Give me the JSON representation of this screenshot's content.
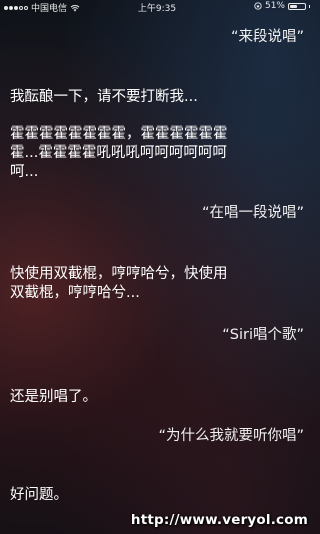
{
  "status_bar": {
    "carrier": "中国电信",
    "time": "上午9:35",
    "battery_text": "51%",
    "battery_level": 0.51,
    "signal_filled": 3,
    "signal_total": 5
  },
  "conversation": [
    {
      "role": "user",
      "text": "“来段说唱”"
    },
    {
      "role": "siri",
      "lines": [
        "我酝酿一下，请不要打断我..."
      ]
    },
    {
      "role": "siri",
      "lines": [
        "霍霍霍霍霍霍霍霍，霍霍霍霍霍霍",
        "霍...霍霍霍霍吼吼吼呵呵呵呵呵呵",
        "呵..."
      ]
    },
    {
      "role": "user",
      "text": "“在唱一段说唱”"
    },
    {
      "role": "siri",
      "lines": [
        "快使用双截棍，哼哼哈兮，快使用",
        "双截棍，哼哼哈兮..."
      ]
    },
    {
      "role": "user",
      "text": "“Siri唱个歌”"
    },
    {
      "role": "siri",
      "lines": [
        "还是别唱了。"
      ]
    },
    {
      "role": "user",
      "text": "“为什么我就要听你唱”"
    },
    {
      "role": "siri",
      "lines": [
        "好问题。"
      ]
    }
  ],
  "watermark": "http://www.veryol.com",
  "colors": {
    "text": "#ffffff",
    "underline": "#3d7bd9"
  }
}
